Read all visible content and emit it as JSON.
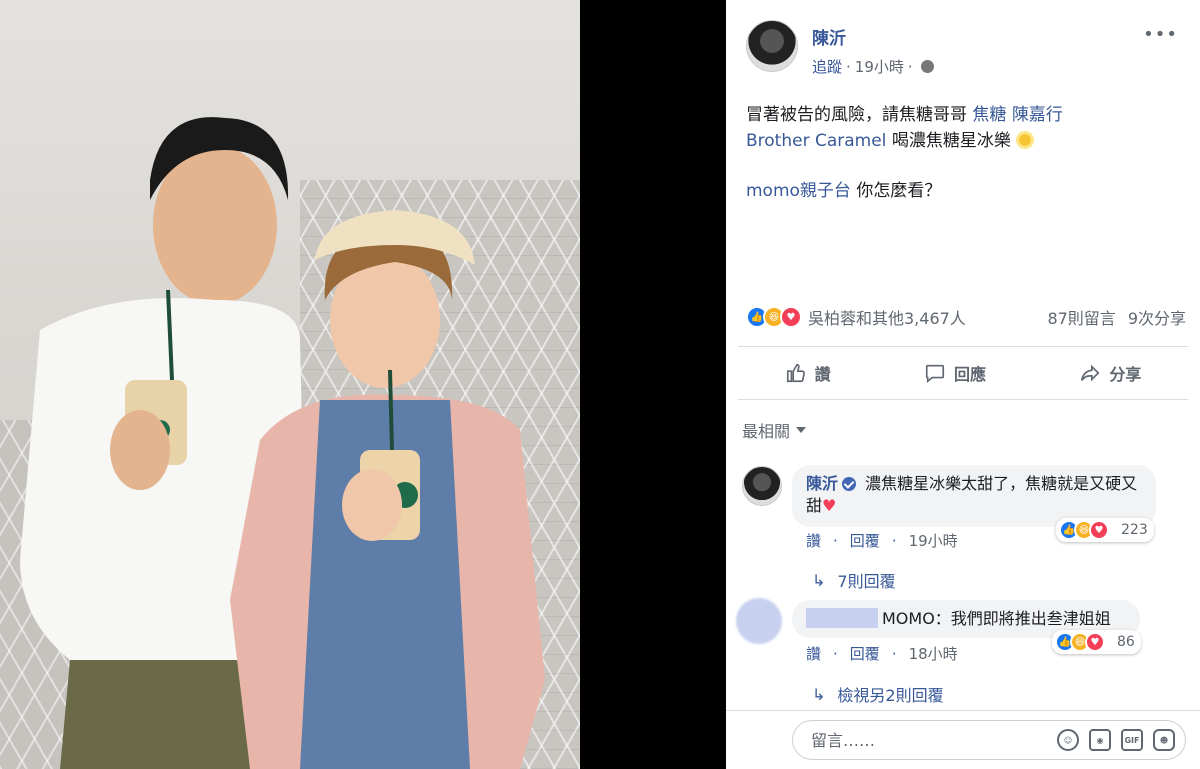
{
  "post": {
    "author": "陳沂",
    "follow_label": "追蹤",
    "time": "19小時",
    "text_line1_a": "冒著被告的風險，請焦糖哥哥",
    "link_caramel": "焦糖",
    "link_chen": "陳嘉行",
    "link_brother": "Brother Caramel",
    "text_line2_b": "喝濃焦糖星冰樂",
    "link_momo": "momo親子台",
    "text_line3_b": "你怎麼看？",
    "more_label": "•••"
  },
  "counts": {
    "reactions_text": "吳柏蓉和其他3,467人",
    "comments": "87則留言",
    "shares": "9次分享"
  },
  "actions": {
    "like": "讚",
    "comment": "回應",
    "share": "分享"
  },
  "sort": {
    "label": "最相關"
  },
  "comments": [
    {
      "name": "陳沂",
      "text": "濃焦糖星冰樂太甜了，焦糖就是又硬又甜",
      "reaction_count": "223",
      "like_label": "讚",
      "reply_label": "回覆",
      "time": "19小時",
      "replies_label": "7則回覆"
    },
    {
      "name_suffix": "MOMO",
      "text": "：我們即將推出叁津姐姐",
      "reaction_count": "86",
      "like_label": "讚",
      "reply_label": "回覆",
      "time": "18小時",
      "replies_label": "檢視另2則回覆"
    }
  ],
  "composer": {
    "placeholder": "留言……"
  },
  "colors": {
    "link": "#385898",
    "meta": "#606770",
    "like_blue": "#1877f2",
    "love_red": "#f33e58",
    "haha_yellow": "#f7b125"
  }
}
